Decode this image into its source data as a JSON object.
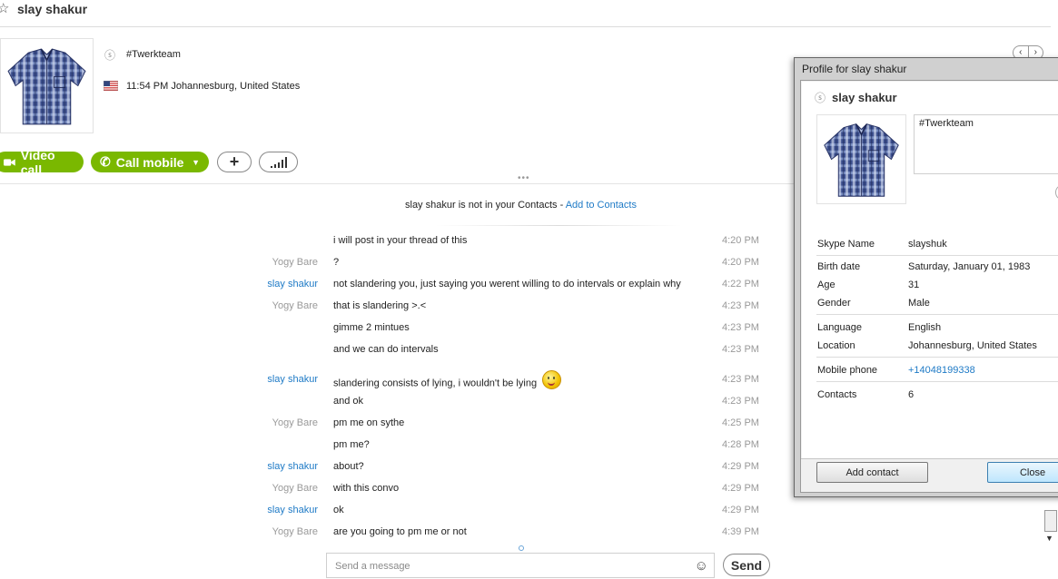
{
  "header": {
    "title": "slay shakur"
  },
  "profile": {
    "mood": "#Twerkteam",
    "location_time": "11:54 PM Johannesburg, United States"
  },
  "actions": {
    "video_call": "Video call",
    "call_mobile": "Call mobile"
  },
  "notice": {
    "text": "slay shakur is not in your Contacts - ",
    "link": "Add to Contacts"
  },
  "messages": [
    {
      "sender": "",
      "text": "i will post in your thread of this",
      "time": "4:20 PM"
    },
    {
      "sender": "Yogy Bare",
      "text": "?",
      "time": "4:20 PM"
    },
    {
      "sender": "slay shakur",
      "text": "not slandering you, just saying you werent willing to do intervals or explain why",
      "time": "4:22 PM"
    },
    {
      "sender": "Yogy Bare",
      "text": "that is slandering >.<",
      "time": "4:23 PM"
    },
    {
      "sender": "",
      "text": "gimme 2 mintues",
      "time": "4:23 PM"
    },
    {
      "sender": "",
      "text": "and we can do intervals",
      "time": "4:23 PM"
    },
    {
      "sender": "slay shakur",
      "text": "slandering consists of lying, i wouldn't be lying",
      "time": "4:23 PM",
      "emoji": "smiley"
    },
    {
      "sender": "",
      "text": "and ok",
      "time": "4:23 PM"
    },
    {
      "sender": "Yogy Bare",
      "text": "pm me on sythe",
      "time": "4:25 PM"
    },
    {
      "sender": "",
      "text": "pm me?",
      "time": "4:28 PM"
    },
    {
      "sender": "slay shakur",
      "text": "about?",
      "time": "4:29 PM"
    },
    {
      "sender": "Yogy Bare",
      "text": "with this convo",
      "time": "4:29 PM"
    },
    {
      "sender": "slay shakur",
      "text": "ok",
      "time": "4:29 PM"
    },
    {
      "sender": "Yogy Bare",
      "text": "are you going to pm me or not",
      "time": "4:39 PM"
    }
  ],
  "composer": {
    "placeholder": "Send a message",
    "send_label": "Send"
  },
  "dialog": {
    "title": "Profile for slay shakur",
    "name": "slay shakur",
    "mood": "#Twerkteam",
    "fields": {
      "skype_name": {
        "label": "Skype Name",
        "value": "slayshuk"
      },
      "birth_date": {
        "label": "Birth date",
        "value": "Saturday, January 01, 1983"
      },
      "age": {
        "label": "Age",
        "value": "31"
      },
      "gender": {
        "label": "Gender",
        "value": "Male"
      },
      "language": {
        "label": "Language",
        "value": "English"
      },
      "location": {
        "label": "Location",
        "value": "Johannesburg, United States"
      },
      "mobile": {
        "label": "Mobile phone",
        "value": "+14048199338"
      },
      "contacts": {
        "label": "Contacts",
        "value": "6"
      }
    },
    "add_contact": "Add contact",
    "close": "Close"
  },
  "colors": {
    "green": "#7ab800",
    "link": "#1e7ac6",
    "sender_other": "#999999"
  },
  "icons": [
    "star-icon",
    "mood-icon",
    "us-flag-icon",
    "video-icon",
    "phone-icon",
    "dropdown-arrow-icon",
    "plus-icon",
    "signal-icon",
    "emoji-icon",
    "smiley-icon"
  ]
}
